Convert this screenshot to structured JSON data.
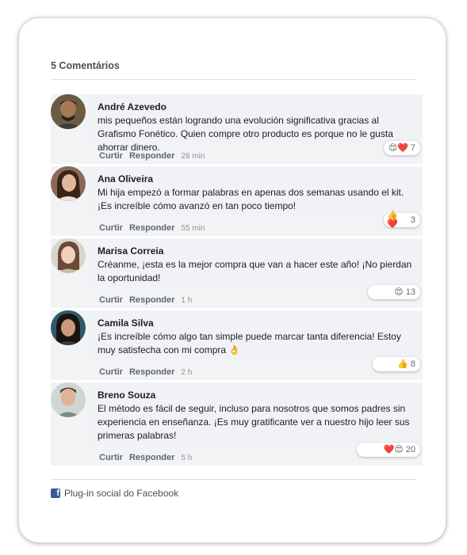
{
  "header": {
    "count_label": "5 Comentários"
  },
  "comments": [
    {
      "author": "André Azevedo",
      "text": "mis pequeños están logrando una evolución significativa gracias al Grafismo Fonético. Quien compre otro producto es porque no le gusta ahorrar dinero.",
      "reactions": "😍❤️",
      "reaction_count": "7",
      "like": "Curtir",
      "reply": "Responder",
      "time": "28 min"
    },
    {
      "author": "Ana Oliveira",
      "text": "Mi hija empezó a formar palabras en apenas dos semanas usando el kit. ¡Es increíble cómo avanzó en tan poco tiempo!",
      "reactions": "👍❤️",
      "reaction_count": "3",
      "like": "Curtir",
      "reply": "Responder",
      "time": "55 min"
    },
    {
      "author": "Marisa Correia",
      "text": "Créanme, ¡esta es la mejor compra que van a hacer este año! ¡No pierdan la oportunidad!",
      "reactions": "😍",
      "reaction_count": "13",
      "like": "Curtir",
      "reply": "Responder",
      "time": "1 h"
    },
    {
      "author": "Camila Silva",
      "text": "¡Es increíble cómo algo tan simple puede marcar tanta diferencia! Estoy muy satisfecha con mi compra 👌",
      "reactions": "👍",
      "reaction_count": "8",
      "like": "Curtir",
      "reply": "Responder",
      "time": "2 h"
    },
    {
      "author": "Breno Souza",
      "text": "El método es fácil de seguir, incluso para nosotros que somos padres sin experiencia en enseñanza. ¡Es muy gratificante ver a nuestro hijo leer sus primeras palabras!",
      "reactions": "❤️😍",
      "reaction_count": "20",
      "like": "Curtir",
      "reply": "Responder",
      "time": "5 h"
    }
  ],
  "footer": {
    "label": "Plug-in social do Facebook",
    "icon": "facebook-icon"
  }
}
